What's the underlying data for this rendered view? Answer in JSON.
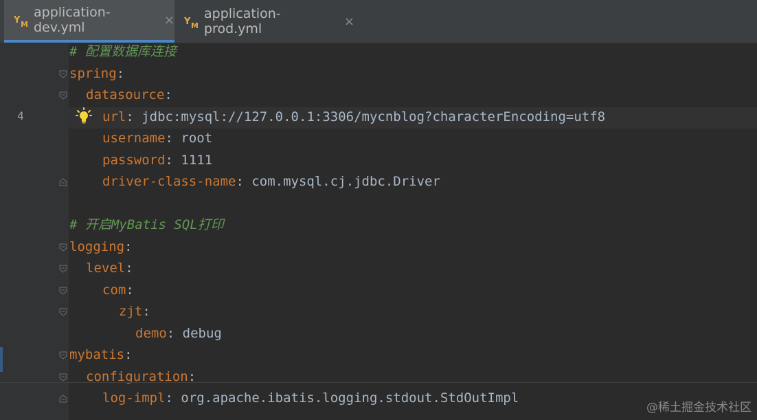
{
  "tabs": [
    {
      "label": "application-dev.yml",
      "active": true
    },
    {
      "label": "application-prod.yml",
      "active": false
    }
  ],
  "close_glyph": "×",
  "current_line_number": "4",
  "lines": [
    {
      "comment": "# 配置数据库连接"
    },
    {
      "key": "spring",
      "punc": ":"
    },
    {
      "key": "datasource",
      "punc": ":"
    },
    {
      "key": "url",
      "punc": ":",
      "val": " jdbc:mysql://127.0.0.1:3306/mycnblog?characterEncoding=utf8"
    },
    {
      "key": "username",
      "punc": ":",
      "val": " root"
    },
    {
      "key": "password",
      "punc": ":",
      "val": " 1111"
    },
    {
      "key": "driver-class-name",
      "punc": ":",
      "val": " com.mysql.cj.jdbc.Driver"
    },
    {},
    {
      "comment": "# 开启MyBatis SQL打印"
    },
    {
      "key": "logging",
      "punc": ":"
    },
    {
      "key": "level",
      "punc": ":"
    },
    {
      "key": "com",
      "punc": ":"
    },
    {
      "key": "zjt",
      "punc": ":"
    },
    {
      "key": "demo",
      "punc": ":",
      "val": " debug"
    },
    {
      "key": "mybatis",
      "punc": ":"
    },
    {
      "key": "configuration",
      "punc": ":"
    },
    {
      "key": "log-impl",
      "punc": ":",
      "val": " org.apache.ibatis.logging.stdout.StdOutImpl"
    }
  ],
  "watermark": "@稀土掘金技术社区",
  "colors": {
    "background": "#2b2b2b",
    "tabbar": "#3c3f41",
    "active_tab_underline": "#4a88c7",
    "yaml_key": "#cc7832",
    "yaml_value": "#a9b7c6",
    "comment": "#629755",
    "bulb": "#f5d538"
  },
  "icons": [
    "yaml-file-icon",
    "close-icon",
    "fold-marker-icon",
    "lightbulb-icon"
  ]
}
